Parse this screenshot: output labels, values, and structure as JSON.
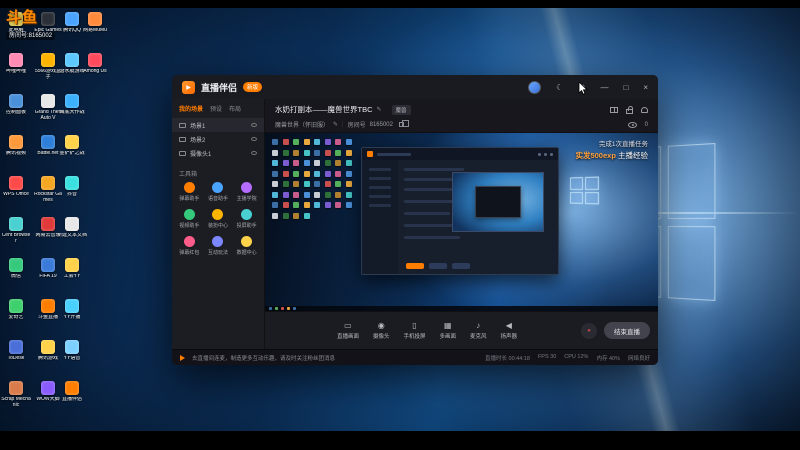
{
  "colors": {
    "accent": "#ff7e00",
    "wallpaper_blue": "#155a9e"
  },
  "watermark": {
    "logo": "斗鱼",
    "room": "房间号:8165002"
  },
  "desktop": {
    "col1": [
      {
        "label": "此电脑",
        "color": "#d9c24a"
      },
      {
        "label": "哔哩哔哩",
        "color": "#ff8ab3"
      },
      {
        "label": "控制面板",
        "color": "#4a90d9"
      },
      {
        "label": "腾讯视频",
        "color": "#ff9a3c"
      },
      {
        "label": "WPS Office",
        "color": "#ff4a4a"
      },
      {
        "label": "Cent Browser",
        "color": "#4ad0d0"
      },
      {
        "label": "微信",
        "color": "#35c97c"
      },
      {
        "label": "爱奇艺",
        "color": "#3fd06e"
      },
      {
        "label": "ToDesk",
        "color": "#4a6fd9"
      },
      {
        "label": "Scrap Mechanic",
        "color": "#d97b4a"
      }
    ],
    "col2": [
      {
        "label": "Epic Games",
        "color": "#2b2f36"
      },
      {
        "label": "5566游戏盒子",
        "color": "#ffb400"
      },
      {
        "label": "Grand Theft Auto V",
        "color": "#e8e8e8"
      },
      {
        "label": "Battle.net",
        "color": "#2e7fd9"
      },
      {
        "label": "Rockstar Games",
        "color": "#f5a623"
      },
      {
        "label": "网易云音乐",
        "color": "#e03a3a"
      },
      {
        "label": "FIFA 19",
        "color": "#3a7bd9"
      },
      {
        "label": "斗鱼直播",
        "color": "#ff7e00"
      },
      {
        "label": "腾讯游戏",
        "color": "#ffd24a"
      },
      {
        "label": "WOW大脚",
        "color": "#8a5cff"
      }
    ],
    "col3": [
      {
        "label": "腾讯QQ",
        "color": "#4aa3ff"
      },
      {
        "label": "潜水艇游戏",
        "color": "#5cc8ff"
      },
      {
        "label": "海底大作战",
        "color": "#3ab0ff"
      },
      {
        "label": "金铲铲之战",
        "color": "#ffd24a"
      },
      {
        "label": "抖音",
        "color": "#3ae0e0"
      },
      {
        "label": "新建文本文档",
        "color": "#e8e8e8"
      },
      {
        "label": "工会YY",
        "color": "#ffd24a"
      },
      {
        "label": "YY开播",
        "color": "#4ad0ff"
      },
      {
        "label": "YY语音",
        "color": "#7cd0ff"
      },
      {
        "label": "直播伴侣",
        "color": "#ff7e00"
      }
    ],
    "col4": [
      {
        "label": "网易MuMu",
        "color": "#ff8a3c"
      },
      {
        "label": "Among Us",
        "color": "#ff4a5e"
      }
    ]
  },
  "app": {
    "titlebar": {
      "logo_glyph": "▶",
      "logo_text": "直播伴侣",
      "badge": "新版",
      "icons": {
        "theme": "☾",
        "settings": "⚙",
        "min": "—",
        "max": "□",
        "close": "×"
      }
    },
    "info": {
      "title": "水奶打副本——魔兽世界TBC",
      "edit_icon": "✎",
      "tag": "魔兽",
      "category": "魔兽世界（怀旧服）",
      "room_label": "房间号",
      "room_id": "8165002",
      "viewers": "0"
    },
    "sidebar": {
      "tabs": [
        {
          "label": "我的场景"
        },
        {
          "label": "预设"
        },
        {
          "label": "布局"
        }
      ],
      "scenes": [
        {
          "name": "场景1"
        },
        {
          "name": "场景2"
        },
        {
          "name": "摄像头1"
        }
      ],
      "toolbox_title": "工具箱",
      "tools": [
        {
          "label": "弹幕助手",
          "color": "#ff7e00"
        },
        {
          "label": "语音助手",
          "color": "#4aa3ff"
        },
        {
          "label": "主播学院",
          "color": "#b56cff"
        },
        {
          "label": "视频助手",
          "color": "#35c97c"
        },
        {
          "label": "装扮中心",
          "color": "#ffb400"
        },
        {
          "label": "投屏助手",
          "color": "#4ad0d0"
        },
        {
          "label": "弹幕红包",
          "color": "#ff5c8a"
        },
        {
          "label": "互动玩法",
          "color": "#7c87ff"
        },
        {
          "label": "数据中心",
          "color": "#ffd24a"
        }
      ]
    },
    "preview": {
      "task_line1": "完成1次直播任务",
      "task_highlight": "实发500exp",
      "task_rest": " 主播经验",
      "capture_icons": [
        "#3a6ea5",
        "#c94f4f",
        "#55b05c",
        "#e8a83e",
        "#52b8d8",
        "#7a5cd0",
        "#c95c8a",
        "#4a90d9",
        "#c8ccd4",
        "#2f6f3a",
        "#b08030",
        "#44c4c4",
        "#3a6ea5",
        "#c94f4f",
        "#55b05c",
        "#e8a83e",
        "#52b8d8",
        "#7a5cd0",
        "#c95c8a",
        "#4a90d9",
        "#c8ccd4",
        "#2f6f3a",
        "#b08030",
        "#44c4c4",
        "#3a6ea5",
        "#c94f4f",
        "#55b05c",
        "#e8a83e",
        "#52b8d8",
        "#7a5cd0",
        "#c95c8a",
        "#4a90d9",
        "#c8ccd4",
        "#2f6f3a",
        "#b08030",
        "#44c4c4",
        "#3a6ea5",
        "#c94f4f",
        "#55b05c",
        "#e8a83e",
        "#52b8d8",
        "#7a5cd0",
        "#c95c8a",
        "#4a90d9",
        "#c8ccd4",
        "#2f6f3a",
        "#b08030",
        "#44c4c4",
        "#3a6ea5",
        "#c94f4f",
        "#55b05c",
        "#e8a83e",
        "#52b8d8",
        "#7a5cd0",
        "#c95c8a",
        "#4a90d9",
        "#c8ccd4",
        "#2f6f3a",
        "#b08030",
        "#44c4c4"
      ]
    },
    "toolbar": {
      "buttons": [
        {
          "label": "直播画面",
          "icon": "▭"
        },
        {
          "label": "摄像头",
          "icon": "◉"
        },
        {
          "label": "手机投屏",
          "icon": "▯"
        },
        {
          "label": "多画面",
          "icon": "▦"
        },
        {
          "label": "麦克风",
          "icon": "♪"
        },
        {
          "label": "扬声器",
          "icon": "◀"
        }
      ],
      "record_icon": "●",
      "stop_label": "结束直播"
    },
    "statusbar": {
      "notice": "去直播间连麦，制造更多互动乐趣，请及时关注粉丝团消息",
      "stats": [
        "直播时长 00:44:18",
        "FPS 30",
        "CPU 12%",
        "内存 40%",
        "网络良好"
      ]
    }
  }
}
